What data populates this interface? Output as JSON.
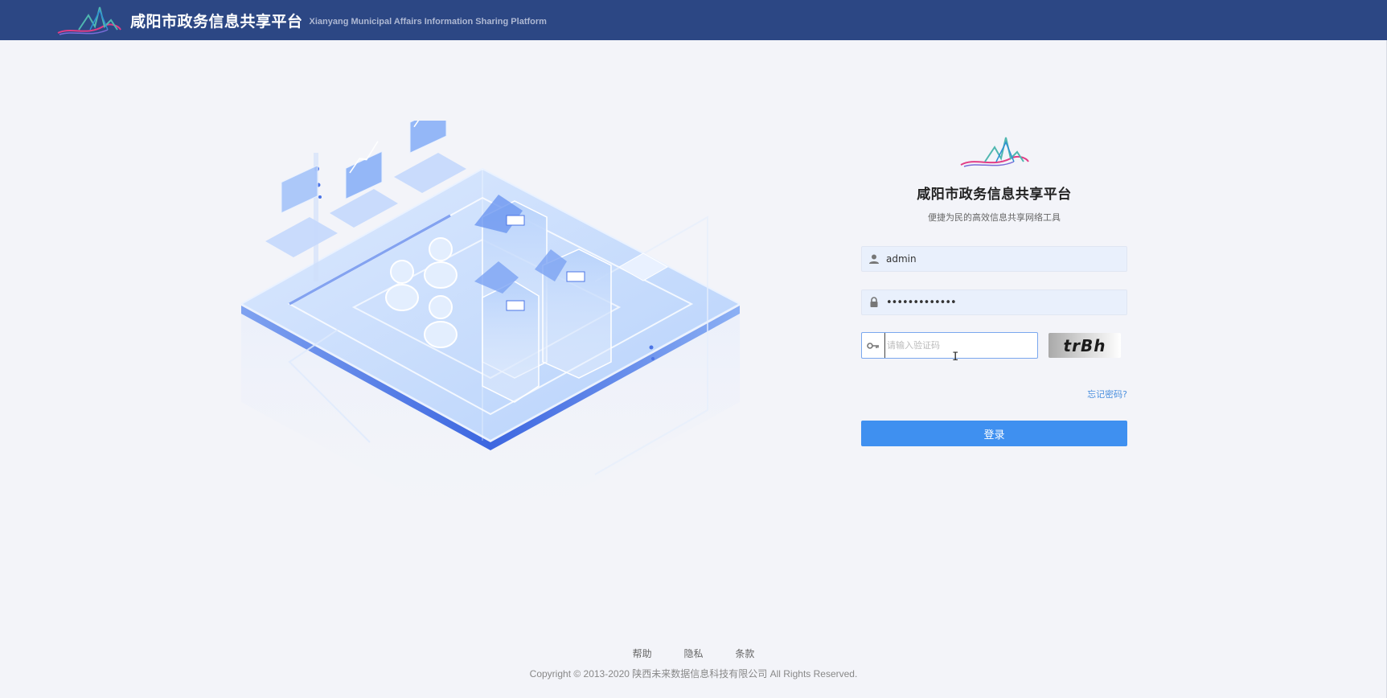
{
  "header": {
    "title": "咸阳市政务信息共享平台",
    "subtitle": "Xianyang Municipal Affairs Information Sharing Platform",
    "logo_icon": "mountain-ribbon-logo"
  },
  "login": {
    "title": "咸阳市政务信息共享平台",
    "subtitle": "便捷为民的高效信息共享网络工具",
    "username": "admin",
    "password_mask": "•••••••••••••",
    "captcha_placeholder": "请输入验证码",
    "captcha_text": "trBh",
    "forgot_label": "忘记密码?",
    "submit_label": "登录",
    "icons": {
      "user": "user-icon",
      "lock": "lock-icon",
      "key": "key-icon"
    }
  },
  "footer": {
    "links": [
      "帮助",
      "隐私",
      "条款"
    ],
    "copyright": "Copyright © 2013-2020 陕西未来数据信息科技有限公司 All Rights Reserved."
  },
  "colors": {
    "header_bg": "#2c4784",
    "page_bg": "#f3f4f9",
    "primary": "#3f90f0",
    "link": "#4a8fde"
  }
}
